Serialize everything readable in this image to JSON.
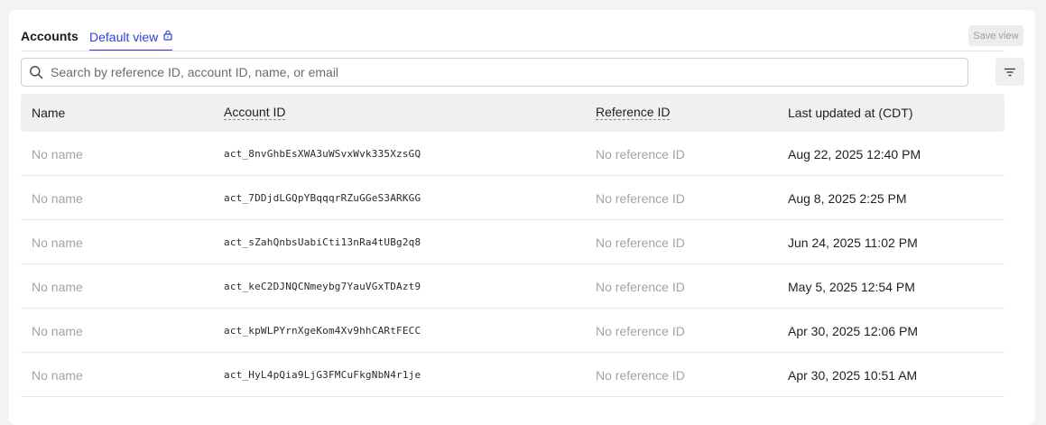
{
  "tabs": {
    "accounts_label": "Accounts",
    "default_view_label": "Default view"
  },
  "toolbar": {
    "save_view_label": "Save view"
  },
  "search": {
    "placeholder": "Search by reference ID, account ID, name, or email",
    "value": ""
  },
  "table": {
    "columns": [
      "Name",
      "Account ID",
      "Reference ID",
      "Last updated at (CDT)"
    ],
    "rows": [
      {
        "name": "No name",
        "account_id": "act_8nvGhbEsXWA3uWSvxWvk335XzsGQ",
        "reference_id": "No reference ID",
        "last_updated": "Aug 22, 2025 12:40 PM"
      },
      {
        "name": "No name",
        "account_id": "act_7DDjdLGQpYBqqqrRZuGGeS3ARKGG",
        "reference_id": "No reference ID",
        "last_updated": "Aug 8, 2025 2:25 PM"
      },
      {
        "name": "No name",
        "account_id": "act_sZahQnbsUabiCti13nRa4tUBg2q8",
        "reference_id": "No reference ID",
        "last_updated": "Jun 24, 2025 11:02 PM"
      },
      {
        "name": "No name",
        "account_id": "act_keC2DJNQCNmeybg7YauVGxTDAzt9",
        "reference_id": "No reference ID",
        "last_updated": "May 5, 2025 12:54 PM"
      },
      {
        "name": "No name",
        "account_id": "act_kpWLPYrnXgeKom4Xv9hhCARtFECC",
        "reference_id": "No reference ID",
        "last_updated": "Apr 30, 2025 12:06 PM"
      },
      {
        "name": "No name",
        "account_id": "act_HyL4pQia9LjG3FMCuFkgNbN4r1je",
        "reference_id": "No reference ID",
        "last_updated": "Apr 30, 2025 10:51 AM"
      }
    ]
  },
  "icons": {
    "lock": "lock-icon",
    "search": "search-icon",
    "filter": "filter-icon"
  },
  "colors": {
    "accent": "#2f3fd8",
    "muted_text": "#a3a3a3",
    "header_bg": "#f0f0f0"
  }
}
